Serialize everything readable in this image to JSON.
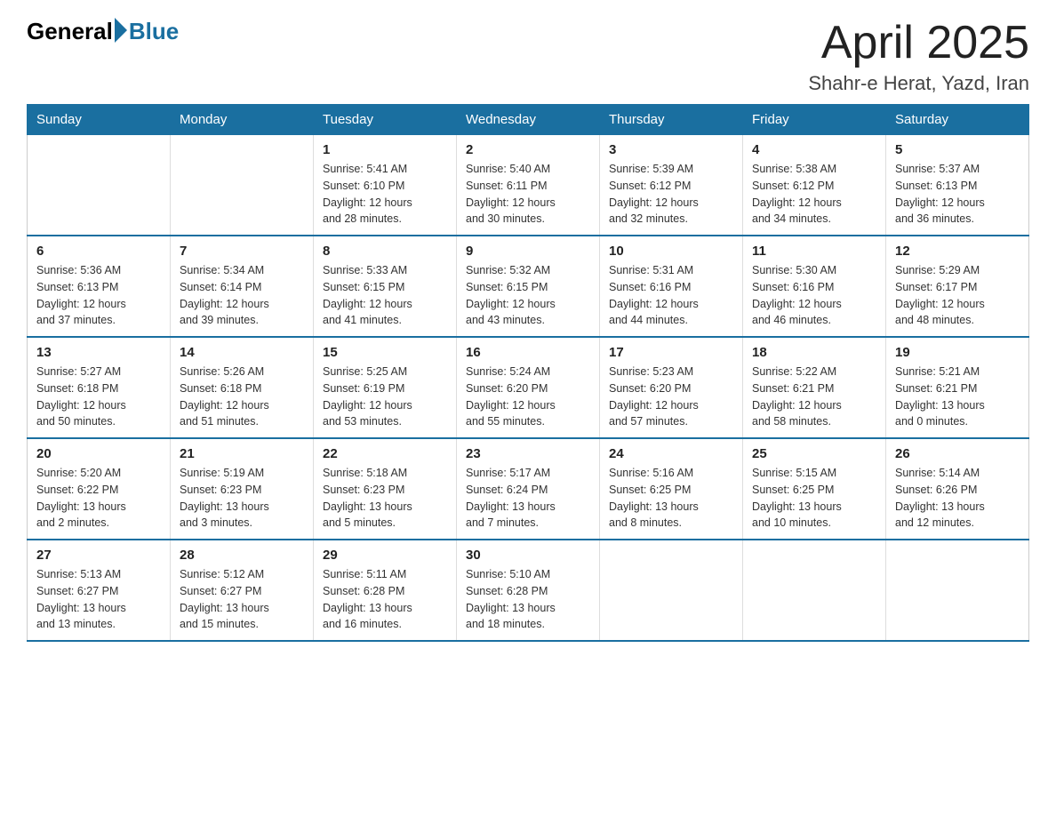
{
  "logo": {
    "text_general": "General",
    "text_blue": "Blue"
  },
  "title": "April 2025",
  "subtitle": "Shahr-e Herat, Yazd, Iran",
  "days_of_week": [
    "Sunday",
    "Monday",
    "Tuesday",
    "Wednesday",
    "Thursday",
    "Friday",
    "Saturday"
  ],
  "weeks": [
    [
      {
        "day": "",
        "info": ""
      },
      {
        "day": "",
        "info": ""
      },
      {
        "day": "1",
        "info": "Sunrise: 5:41 AM\nSunset: 6:10 PM\nDaylight: 12 hours\nand 28 minutes."
      },
      {
        "day": "2",
        "info": "Sunrise: 5:40 AM\nSunset: 6:11 PM\nDaylight: 12 hours\nand 30 minutes."
      },
      {
        "day": "3",
        "info": "Sunrise: 5:39 AM\nSunset: 6:12 PM\nDaylight: 12 hours\nand 32 minutes."
      },
      {
        "day": "4",
        "info": "Sunrise: 5:38 AM\nSunset: 6:12 PM\nDaylight: 12 hours\nand 34 minutes."
      },
      {
        "day": "5",
        "info": "Sunrise: 5:37 AM\nSunset: 6:13 PM\nDaylight: 12 hours\nand 36 minutes."
      }
    ],
    [
      {
        "day": "6",
        "info": "Sunrise: 5:36 AM\nSunset: 6:13 PM\nDaylight: 12 hours\nand 37 minutes."
      },
      {
        "day": "7",
        "info": "Sunrise: 5:34 AM\nSunset: 6:14 PM\nDaylight: 12 hours\nand 39 minutes."
      },
      {
        "day": "8",
        "info": "Sunrise: 5:33 AM\nSunset: 6:15 PM\nDaylight: 12 hours\nand 41 minutes."
      },
      {
        "day": "9",
        "info": "Sunrise: 5:32 AM\nSunset: 6:15 PM\nDaylight: 12 hours\nand 43 minutes."
      },
      {
        "day": "10",
        "info": "Sunrise: 5:31 AM\nSunset: 6:16 PM\nDaylight: 12 hours\nand 44 minutes."
      },
      {
        "day": "11",
        "info": "Sunrise: 5:30 AM\nSunset: 6:16 PM\nDaylight: 12 hours\nand 46 minutes."
      },
      {
        "day": "12",
        "info": "Sunrise: 5:29 AM\nSunset: 6:17 PM\nDaylight: 12 hours\nand 48 minutes."
      }
    ],
    [
      {
        "day": "13",
        "info": "Sunrise: 5:27 AM\nSunset: 6:18 PM\nDaylight: 12 hours\nand 50 minutes."
      },
      {
        "day": "14",
        "info": "Sunrise: 5:26 AM\nSunset: 6:18 PM\nDaylight: 12 hours\nand 51 minutes."
      },
      {
        "day": "15",
        "info": "Sunrise: 5:25 AM\nSunset: 6:19 PM\nDaylight: 12 hours\nand 53 minutes."
      },
      {
        "day": "16",
        "info": "Sunrise: 5:24 AM\nSunset: 6:20 PM\nDaylight: 12 hours\nand 55 minutes."
      },
      {
        "day": "17",
        "info": "Sunrise: 5:23 AM\nSunset: 6:20 PM\nDaylight: 12 hours\nand 57 minutes."
      },
      {
        "day": "18",
        "info": "Sunrise: 5:22 AM\nSunset: 6:21 PM\nDaylight: 12 hours\nand 58 minutes."
      },
      {
        "day": "19",
        "info": "Sunrise: 5:21 AM\nSunset: 6:21 PM\nDaylight: 13 hours\nand 0 minutes."
      }
    ],
    [
      {
        "day": "20",
        "info": "Sunrise: 5:20 AM\nSunset: 6:22 PM\nDaylight: 13 hours\nand 2 minutes."
      },
      {
        "day": "21",
        "info": "Sunrise: 5:19 AM\nSunset: 6:23 PM\nDaylight: 13 hours\nand 3 minutes."
      },
      {
        "day": "22",
        "info": "Sunrise: 5:18 AM\nSunset: 6:23 PM\nDaylight: 13 hours\nand 5 minutes."
      },
      {
        "day": "23",
        "info": "Sunrise: 5:17 AM\nSunset: 6:24 PM\nDaylight: 13 hours\nand 7 minutes."
      },
      {
        "day": "24",
        "info": "Sunrise: 5:16 AM\nSunset: 6:25 PM\nDaylight: 13 hours\nand 8 minutes."
      },
      {
        "day": "25",
        "info": "Sunrise: 5:15 AM\nSunset: 6:25 PM\nDaylight: 13 hours\nand 10 minutes."
      },
      {
        "day": "26",
        "info": "Sunrise: 5:14 AM\nSunset: 6:26 PM\nDaylight: 13 hours\nand 12 minutes."
      }
    ],
    [
      {
        "day": "27",
        "info": "Sunrise: 5:13 AM\nSunset: 6:27 PM\nDaylight: 13 hours\nand 13 minutes."
      },
      {
        "day": "28",
        "info": "Sunrise: 5:12 AM\nSunset: 6:27 PM\nDaylight: 13 hours\nand 15 minutes."
      },
      {
        "day": "29",
        "info": "Sunrise: 5:11 AM\nSunset: 6:28 PM\nDaylight: 13 hours\nand 16 minutes."
      },
      {
        "day": "30",
        "info": "Sunrise: 5:10 AM\nSunset: 6:28 PM\nDaylight: 13 hours\nand 18 minutes."
      },
      {
        "day": "",
        "info": ""
      },
      {
        "day": "",
        "info": ""
      },
      {
        "day": "",
        "info": ""
      }
    ]
  ]
}
